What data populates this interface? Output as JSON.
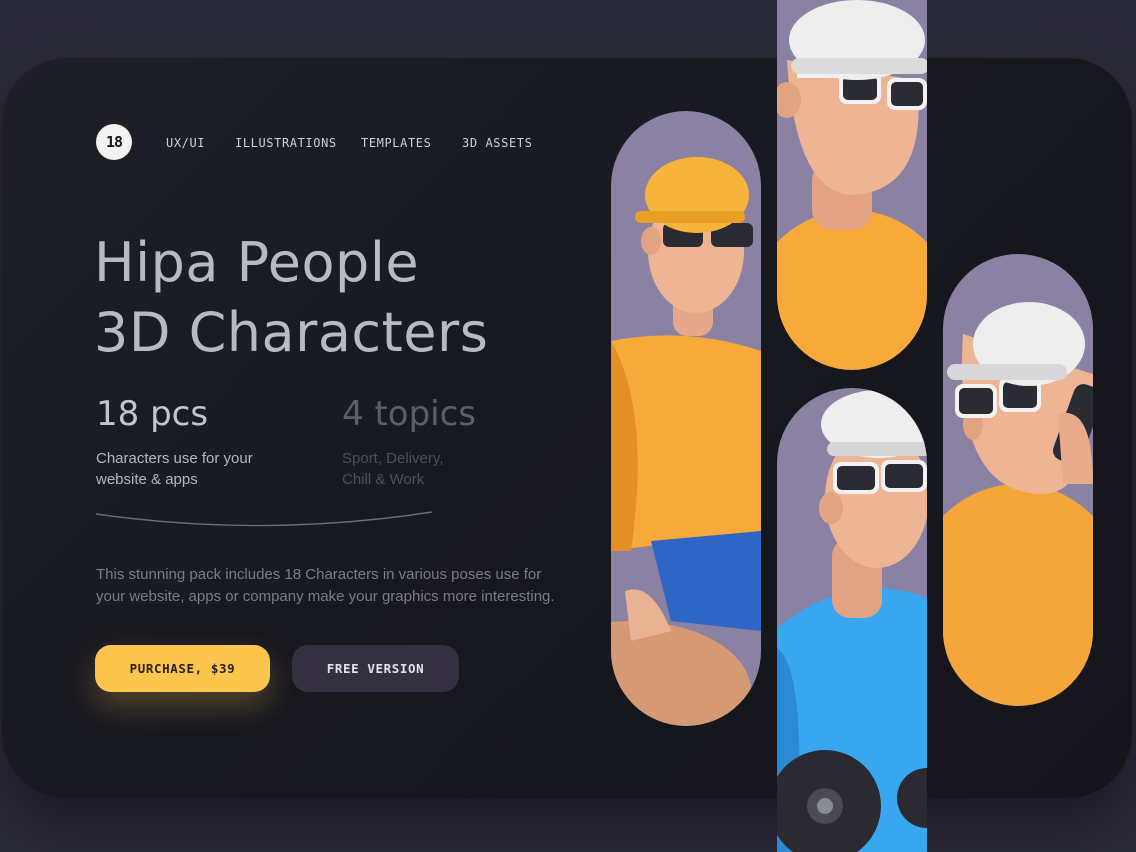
{
  "logo": {
    "text": "18"
  },
  "nav": {
    "items": [
      "UX/UI",
      "ILLUSTRATIONS",
      "TEMPLATES",
      "3D ASSETS"
    ]
  },
  "hero": {
    "title_line1": "Hipa People",
    "title_line2": "3D Characters"
  },
  "stats": [
    {
      "value": "18 pcs",
      "desc_line1": "Characters use for your",
      "desc_line2": "website & apps"
    },
    {
      "value": "4 topics",
      "desc_line1": "Sport, Delivery,",
      "desc_line2": "Chill & Work"
    }
  ],
  "description": {
    "line1": "This stunning pack includes 18 Characters in various poses use for",
    "line2": "your website, apps or company make your graphics more interesting."
  },
  "buttons": {
    "purchase": "PURCHASE, $39",
    "free": "FREE VERSION"
  },
  "colors": {
    "accent": "#fcc54e",
    "background": "#17171e",
    "tile": "#8b82a3",
    "secondary_button": "#34303f"
  },
  "images": [
    "character-yellow-cap-sitting",
    "character-white-cap-portrait",
    "character-blue-shirt-dumbbells",
    "character-white-cap-phone"
  ]
}
